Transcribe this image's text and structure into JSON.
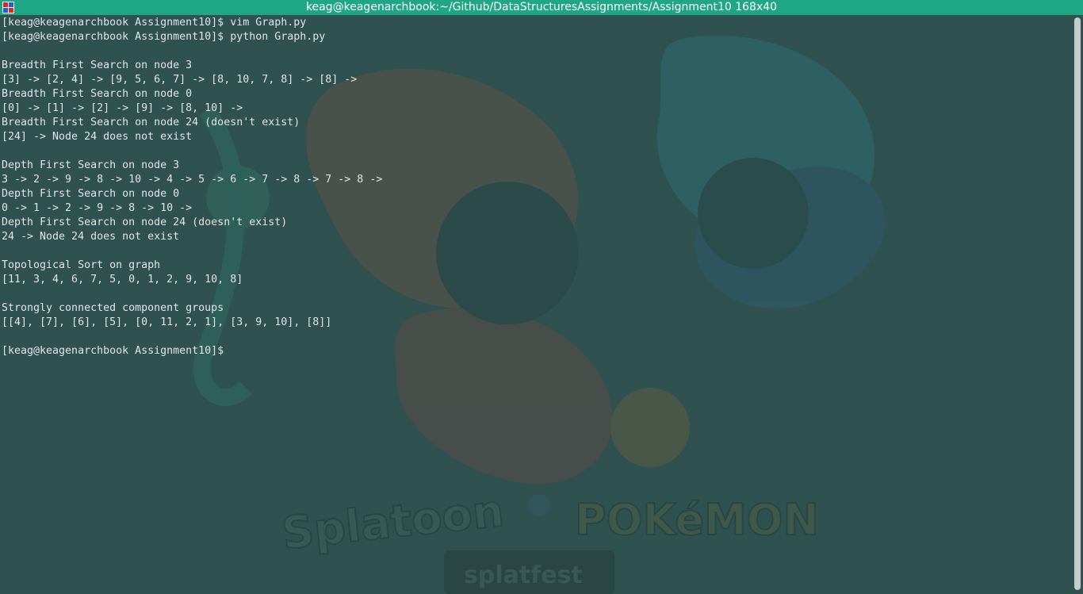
{
  "window": {
    "title": "keag@keagenarchbook:~/Github/DataStructuresAssignments/Assignment10 168x40",
    "accent_color": "#1fa684",
    "background_color": "#2f5150",
    "text_color": "#e2e6e5"
  },
  "terminal": {
    "lines": [
      "[keag@keagenarchbook Assignment10]$ vim Graph.py",
      "[keag@keagenarchbook Assignment10]$ python Graph.py",
      "",
      "Breadth First Search on node 3",
      "[3] -> [2, 4] -> [9, 5, 6, 7] -> [8, 10, 7, 8] -> [8] ->",
      "Breadth First Search on node 0",
      "[0] -> [1] -> [2] -> [9] -> [8, 10] ->",
      "Breadth First Search on node 24 (doesn't exist)",
      "[24] -> Node 24 does not exist",
      "",
      "Depth First Search on node 3",
      "3 -> 2 -> 9 -> 8 -> 10 -> 4 -> 5 -> 6 -> 7 -> 8 -> 7 -> 8 ->",
      "Depth First Search on node 0",
      "0 -> 1 -> 2 -> 9 -> 8 -> 10 ->",
      "Depth First Search on node 24 (doesn't exist)",
      "24 -> Node 24 does not exist",
      "",
      "Topological Sort on graph",
      "[11, 3, 4, 6, 7, 5, 0, 1, 2, 9, 10, 8]",
      "",
      "Strongly connected component groups",
      "[[4], [7], [6], [5], [0, 11, 2, 1], [3, 9, 10], [8]]",
      "",
      "[keag@keagenarchbook Assignment10]$"
    ]
  },
  "wallpaper": {
    "logo_left": "Splatoon",
    "logo_right": "POKéMON",
    "banner": "splatfest"
  },
  "icons": {
    "app_icon": "terminal-app-icon"
  }
}
